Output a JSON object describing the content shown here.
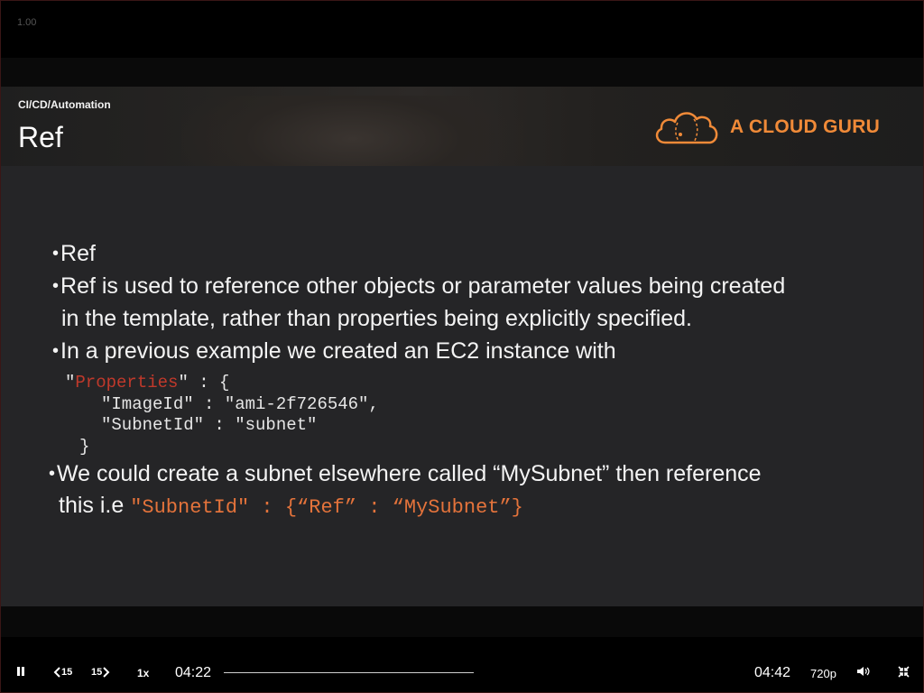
{
  "player": {
    "speed_readout": "1.00",
    "controls": {
      "rewind_label": "15",
      "forward_label": "15",
      "speed_label": "1x",
      "current_time": "04:22",
      "total_time": "04:42",
      "quality_label": "720p",
      "progress_fraction": 0.0
    }
  },
  "slide": {
    "category": "CI/CD/Automation",
    "title": "Ref",
    "logo_text": "A CLOUD GURU",
    "bullets": {
      "b1": "Ref",
      "b2_line1": "Ref is used to reference other objects or parameter values being created",
      "b2_line2": "in the template, rather than properties being explicitly specified.",
      "b3": "In a previous example we created an EC2 instance with",
      "b4_line1": "We could create a subnet elsewhere called “MySubnet” then reference",
      "b4_line2_prefix": "this i.e ",
      "b4_line2_code": "\"SubnetId\" : {“Ref” : “MySubnet”}"
    },
    "bullet_glyph": "•",
    "code": {
      "l1_quote_open": "\"",
      "l1_key": "Properties",
      "l1_rest": "\" : {",
      "l2": "\"ImageId\" : \"ami-2f726546\",",
      "l3": "\"SubnetId\" : \"subnet\"",
      "l4": "}"
    }
  },
  "colors": {
    "accent_orange": "#e4733b",
    "code_red": "#c0392b",
    "logo_orange": "#f08a38"
  },
  "icons": {
    "pause": "pause-icon",
    "rewind": "rewind-15-icon",
    "forward": "forward-15-icon",
    "volume": "volume-icon",
    "exit_fullscreen": "exit-fullscreen-icon",
    "logo": "cloud-logo-icon"
  }
}
